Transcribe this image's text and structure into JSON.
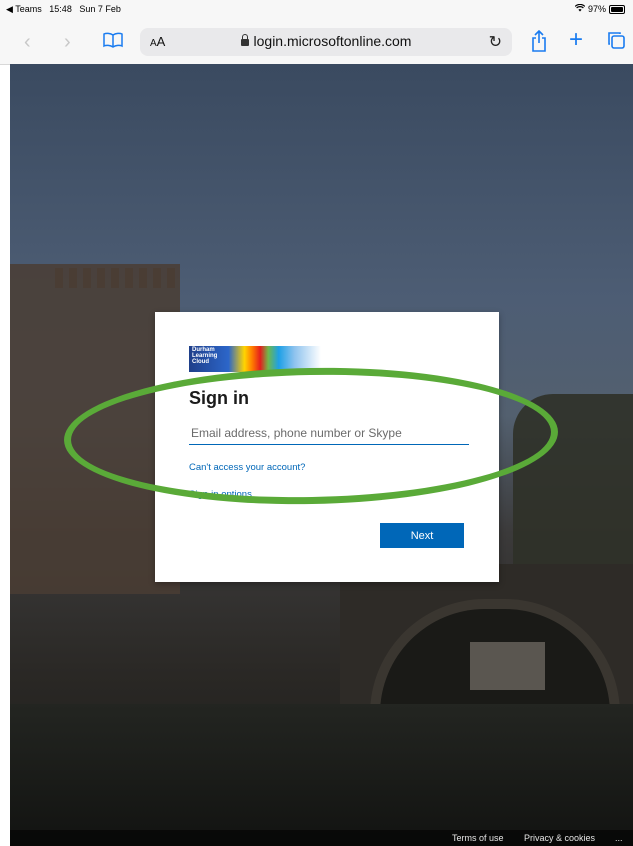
{
  "status_bar": {
    "back_app": "◀ Teams",
    "time": "15:48",
    "date": "Sun 7 Feb",
    "battery": "97%",
    "battery_level": 0.97
  },
  "toolbar": {
    "text_size_label": "AA",
    "url": "login.microsoftonline.com",
    "icons": [
      "back-icon",
      "forward-icon",
      "bookmarks-icon",
      "reload-icon",
      "share-icon",
      "new-tab-icon",
      "tabs-icon"
    ]
  },
  "signin": {
    "logo_text": "Durham Learning Cloud",
    "title": "Sign in",
    "email_placeholder": "Email address, phone number or Skype",
    "cant_access_link": "Can't access your account?",
    "signin_options_link": "Sign-in options",
    "next_button": "Next"
  },
  "footer": {
    "terms": "Terms of use",
    "privacy": "Privacy & cookies",
    "more": "..."
  },
  "colors": {
    "accent": "#0067b8",
    "highlight": "#5aaa38",
    "safari_blue": "#1a7cf0"
  }
}
